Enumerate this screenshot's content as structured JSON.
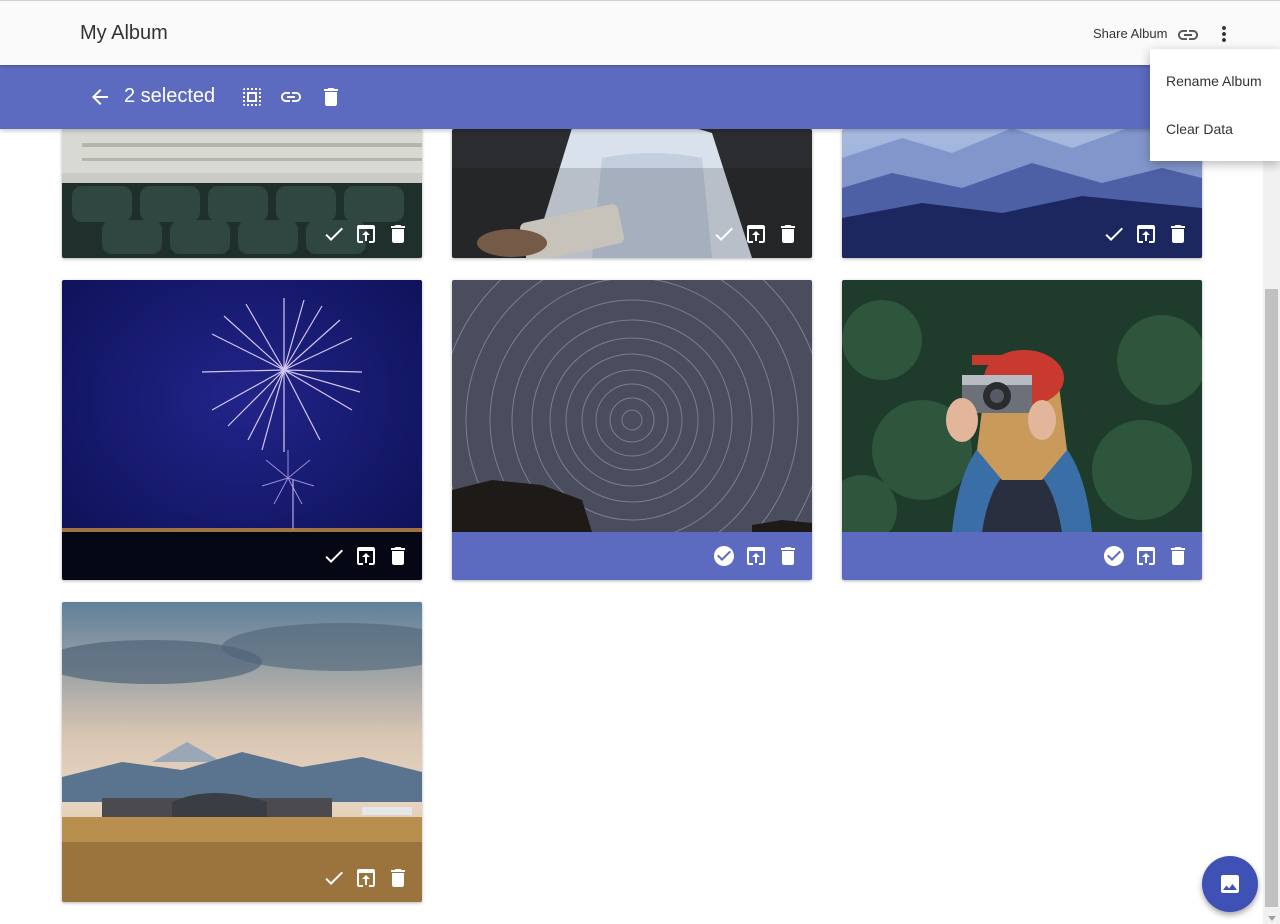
{
  "app": {
    "title": "My Album",
    "share_label": "Share Album",
    "accent": "#5c6bc0",
    "fab_color": "#3f51b5"
  },
  "selection_bar": {
    "count_text": "2 selected",
    "back_icon": "arrow-back-icon",
    "select_all_icon": "select-all-icon",
    "link_icon": "link-icon",
    "delete_icon": "delete-icon"
  },
  "menu": {
    "items": [
      {
        "label": "Rename Album"
      },
      {
        "label": "Clear Data"
      }
    ]
  },
  "photos": [
    {
      "subject": "green leather sofa",
      "selected": false
    },
    {
      "subject": "person reading",
      "selected": false
    },
    {
      "subject": "blue mountains",
      "selected": false
    },
    {
      "subject": "fireworks",
      "selected": false
    },
    {
      "subject": "star trails",
      "selected": true
    },
    {
      "subject": "woman with camera",
      "selected": true
    },
    {
      "subject": "hangar and mountain",
      "selected": false
    }
  ],
  "fab": {
    "icon": "image-icon"
  }
}
